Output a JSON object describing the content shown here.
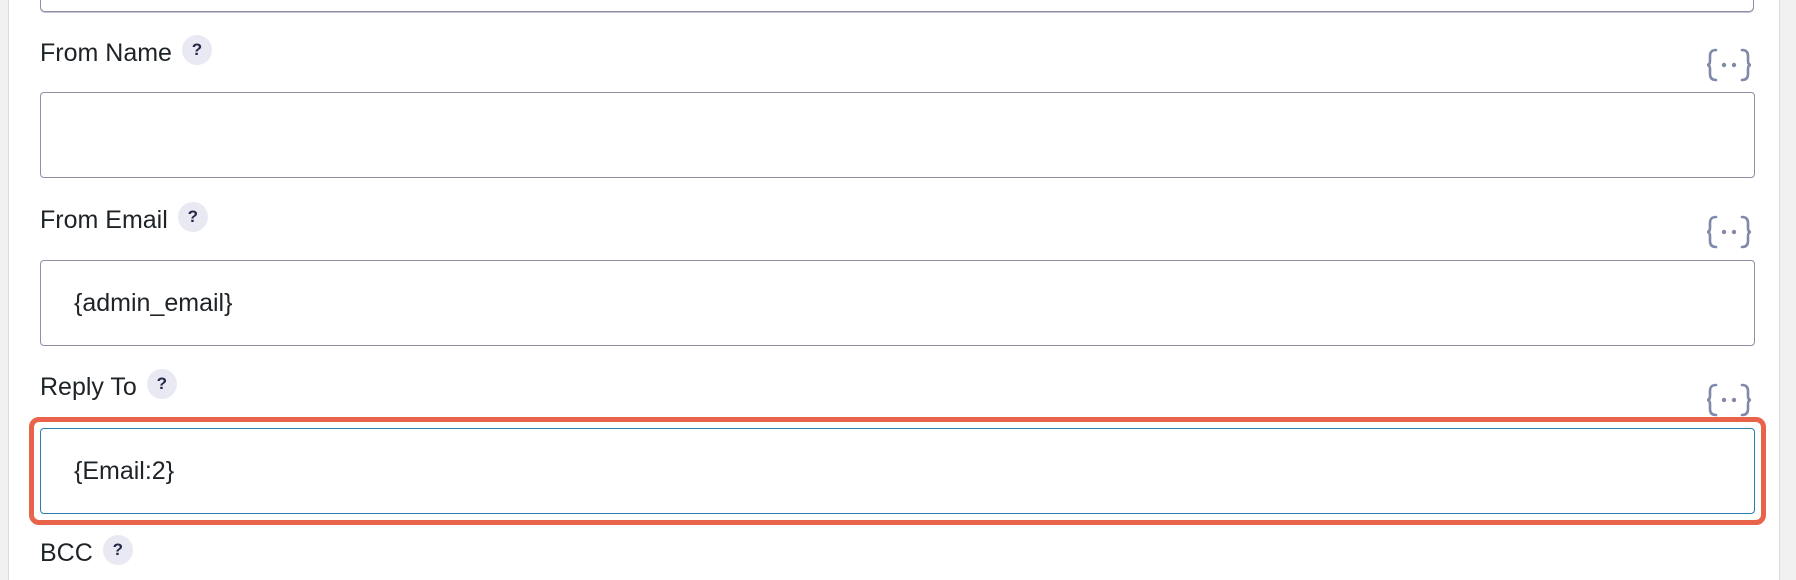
{
  "fields": [
    {
      "label": "From Name",
      "help": "?",
      "value": "",
      "placeholder": ""
    },
    {
      "label": "From Email",
      "help": "?",
      "value": "{admin_email}",
      "placeholder": ""
    },
    {
      "label": "Reply To",
      "help": "?",
      "value": "{Email:2}",
      "placeholder": ""
    },
    {
      "label": "BCC",
      "help": "?"
    }
  ],
  "icons": {
    "merge_tag": "merge-tag-icon",
    "help": "help-icon"
  },
  "colors": {
    "highlight": "#e8634a",
    "focus_border": "#2b7fb0",
    "input_border": "#8c8fa6",
    "merge_tag_icon": "#7e8aa8"
  }
}
